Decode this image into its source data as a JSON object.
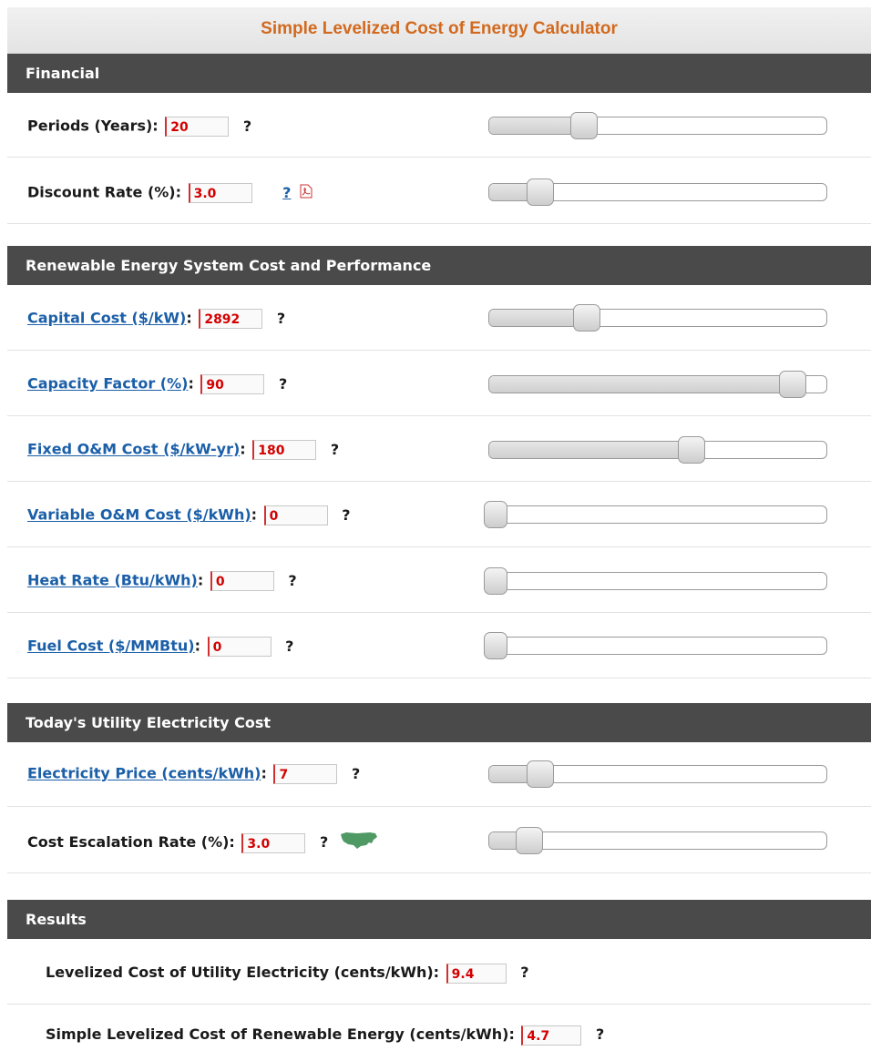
{
  "title": "Simple Levelized Cost of Energy Calculator",
  "sections": {
    "financial": "Financial",
    "renewable": "Renewable Energy System Cost and Performance",
    "utility": "Today's Utility Electricity Cost",
    "results": "Results"
  },
  "fields": {
    "periods": {
      "label": "Periods (Years):",
      "value": "20",
      "help": "?",
      "slider": 0.28
    },
    "discount": {
      "label": "Discount Rate (%):",
      "value": "3.0",
      "help": "?",
      "slider": 0.15
    },
    "capital": {
      "label": "Capital Cost ($/kW)",
      "colon": ":",
      "value": "2892",
      "help": "?",
      "slider": 0.29
    },
    "capacity": {
      "label": "Capacity Factor (%)",
      "colon": ":",
      "value": "90",
      "help": "?",
      "slider": 0.9
    },
    "fixed_om": {
      "label": "Fixed O&M Cost ($/kW-yr)",
      "colon": ":",
      "value": "180",
      "help": "?",
      "slider": 0.6
    },
    "variable_om": {
      "label": "Variable O&M Cost ($/kWh)",
      "colon": ":",
      "value": "0",
      "help": "?",
      "slider": 0.0
    },
    "heat_rate": {
      "label": "Heat Rate (Btu/kWh)",
      "colon": ":",
      "value": "0",
      "help": "?",
      "slider": 0.0
    },
    "fuel_cost": {
      "label": "Fuel Cost ($/MMBtu)",
      "colon": ":",
      "value": "0",
      "help": "?",
      "slider": 0.0
    },
    "elec_price": {
      "label": "Electricity Price (cents/kWh)",
      "colon": ":",
      "value": "7",
      "help": "?",
      "slider": 0.15
    },
    "escalation": {
      "label": "Cost Escalation Rate (%):",
      "value": "3.0",
      "help": "?",
      "slider": 0.12
    }
  },
  "results": {
    "utility_lcoe": {
      "label": "Levelized Cost of Utility Electricity (cents/kWh):",
      "value": "9.4",
      "help": "?"
    },
    "renewable_lcoe": {
      "label": "Simple Levelized Cost of Renewable Energy (cents/kWh):",
      "value": "4.7",
      "help": "?"
    }
  },
  "icons": {
    "pdf": "pdf-icon",
    "map": "us-map-icon"
  }
}
